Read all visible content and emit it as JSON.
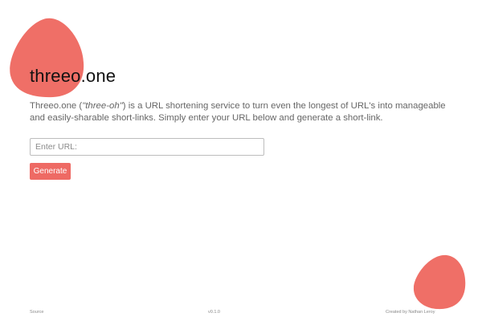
{
  "app": {
    "title": "threeo.one"
  },
  "description": {
    "lead": "Threeo.one (",
    "pronunciation": "\"three-oh\"",
    "rest": ") is a URL shortening service to turn even the longest of URL's into manageable and easily-sharable short-links. Simply enter your URL below and generate a short-link."
  },
  "form": {
    "url_placeholder": "Enter URL:",
    "url_value": "",
    "generate_label": "Generate"
  },
  "footer": {
    "source_label": "Source",
    "version": "v0.1.0",
    "credit": "Created by Nathan Leroy"
  },
  "colors": {
    "accent": "#ee6a64",
    "blob": "#ef6f67"
  }
}
